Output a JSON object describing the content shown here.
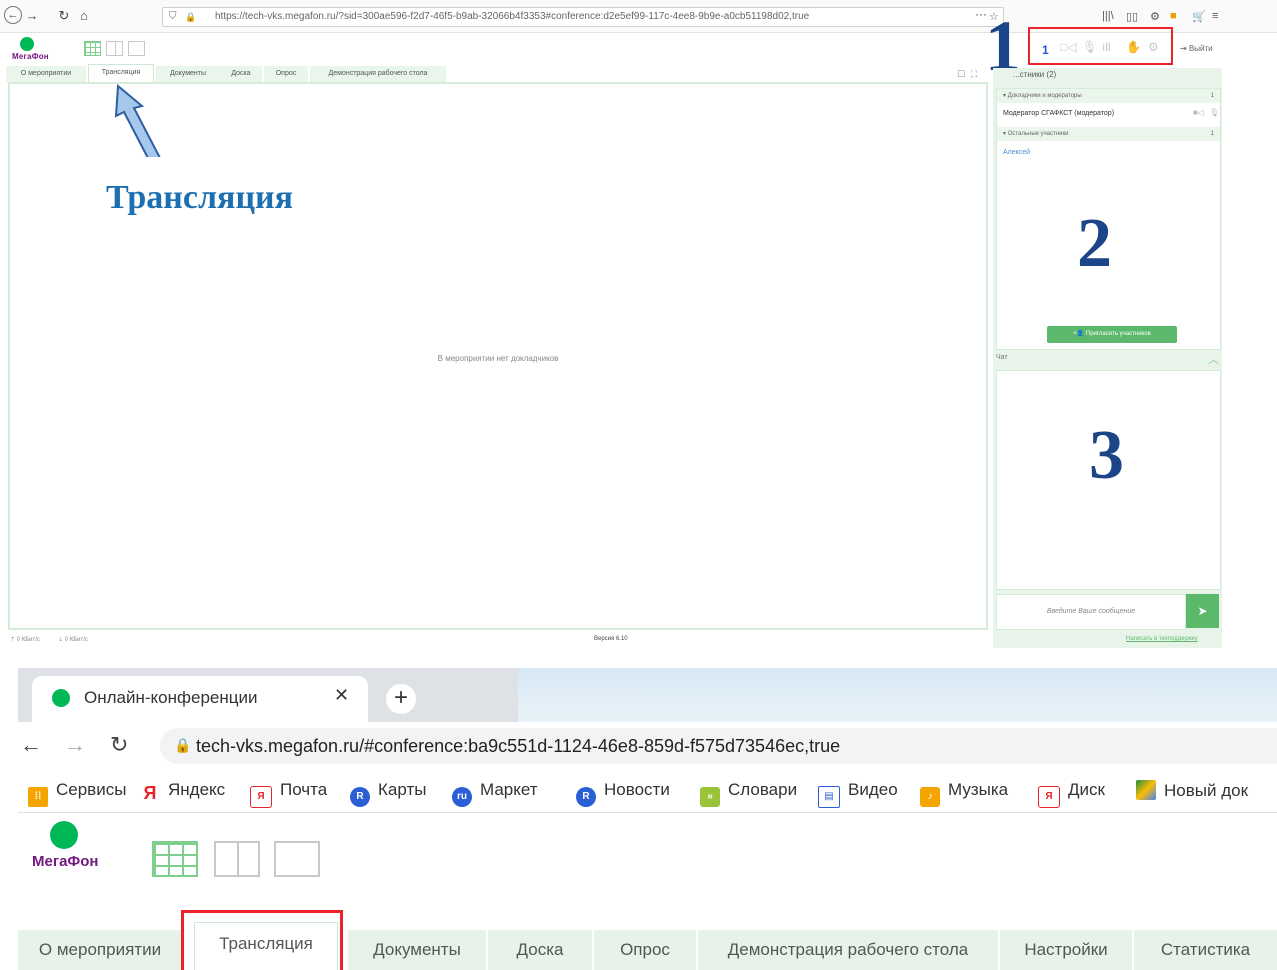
{
  "top": {
    "browser": {
      "url": "https://tech-vks.megafon.ru/?sid=300ae596-f2d7-46f5-b9ab-32066b4f3353#conference:d2e5ef99-117c-4ee8-9b9e-a0cb51198d02,true",
      "nav_icons": [
        "back-icon",
        "forward-icon",
        "reload-icon",
        "home-icon"
      ]
    },
    "logo_text": "МегаФон",
    "controls": {
      "participant_count": "1",
      "exit_label": "Выйти"
    },
    "tabs": [
      "О мероприятии",
      "Трансляция",
      "Документы",
      "Доска",
      "Опрос",
      "Демонстрация рабочего стола"
    ],
    "active_tab": "Трансляция",
    "main_empty_text": "В мероприятии нет докладчиков",
    "participants": {
      "header": "...стники (2)",
      "groups": [
        {
          "label": "Докладчики и модераторы",
          "count": "1",
          "members": [
            "Модератор СГАФКСТ (модератор)"
          ]
        },
        {
          "label": "Остальные участники",
          "count": "1",
          "members": [
            "Алексей"
          ]
        }
      ],
      "invite_label": "Пригласить участников"
    },
    "chat": {
      "header": "Чат",
      "placeholder": "Введите Ваше сообщение"
    },
    "status": {
      "upload": "0 КБит/с",
      "download": "0 КБит/с",
      "version": "Версия 6.10",
      "support_link": "Написать в техподдержку"
    },
    "annotations": {
      "callout": "Трансляция",
      "num1": "1",
      "num2": "2",
      "num3": "3"
    }
  },
  "bottom": {
    "tab_title": "Онлайн-конференции",
    "url": "tech-vks.megafon.ru/#conference:ba9c551d-1124-46e8-859d-f575d73546ec,true",
    "bookmarks": [
      "Сервисы",
      "Яндекс",
      "Почта",
      "Карты",
      "Маркет",
      "Новости",
      "Словари",
      "Видео",
      "Музыка",
      "Диск",
      "Новый док"
    ],
    "logo_text": "МегаФон",
    "tabs": [
      "О мероприятии",
      "Трансляция",
      "Документы",
      "Доска",
      "Опрос",
      "Демонстрация рабочего стола",
      "Настройки",
      "Статистика"
    ],
    "active_tab": "Трансляция"
  },
  "colors": {
    "accent_green": "#00b956",
    "brand_purple": "#731982",
    "highlight_red": "#e8232a",
    "annotation_blue": "#1c4587"
  }
}
